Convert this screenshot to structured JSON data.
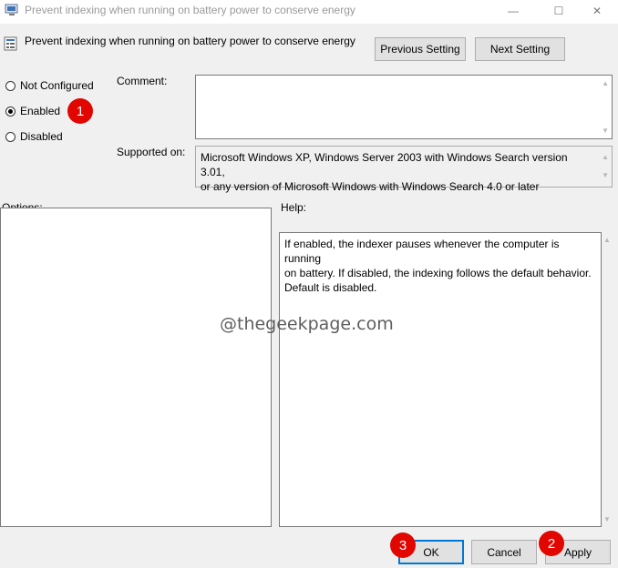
{
  "window": {
    "title": "Prevent indexing when running on battery power to conserve energy",
    "controls": {
      "minimize": "—",
      "maximize": "☐",
      "close": "✕"
    }
  },
  "header": {
    "policy_name": "Prevent indexing when running on battery power to conserve energy",
    "icon": "policy-setting-icon",
    "previous_label": "Previous Setting",
    "next_label": "Next Setting"
  },
  "state": {
    "options": [
      {
        "label": "Not Configured",
        "selected": false
      },
      {
        "label": "Enabled",
        "selected": true
      },
      {
        "label": "Disabled",
        "selected": false
      }
    ]
  },
  "comment": {
    "label": "Comment:",
    "value": ""
  },
  "supported": {
    "label": "Supported on:",
    "line1": "Microsoft Windows XP, Windows Server 2003 with Windows Search version 3.01,",
    "line2": "or any version of Microsoft Windows with Windows Search 4.0 or later"
  },
  "options_panel": {
    "label": "Options:"
  },
  "help_panel": {
    "label": "Help:",
    "line1": "If enabled, the indexer pauses whenever the computer is running",
    "line2": "on battery. If disabled, the indexing follows the default behavior.",
    "line3": "Default is disabled."
  },
  "watermark": "@thegeekpage.com",
  "footer": {
    "ok_label": "OK",
    "cancel_label": "Cancel",
    "apply_label": "Apply"
  },
  "annotations": {
    "step1": "1",
    "step2": "2",
    "step3": "3",
    "color": "#e10600"
  },
  "colors": {
    "accent": "#0078d7"
  }
}
